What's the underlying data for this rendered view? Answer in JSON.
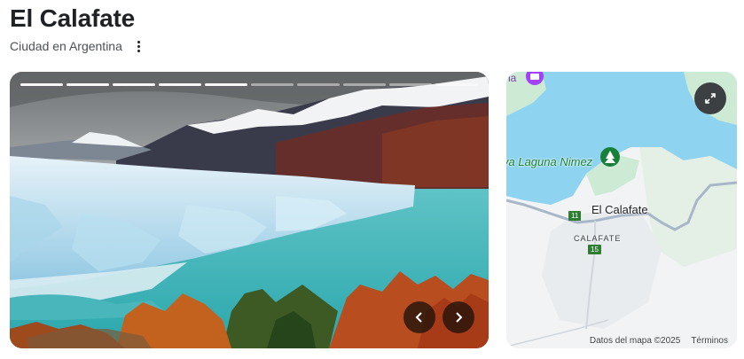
{
  "header": {
    "title": "El Calafate",
    "subtitle": "Ciudad en Argentina",
    "more_icon": "more-vert-icon"
  },
  "photo_carousel": {
    "slide_count": 10,
    "active_slides": 5,
    "prev_icon": "chevron-left-icon",
    "next_icon": "chevron-right-icon"
  },
  "map": {
    "city_label": "El Calafate",
    "area_label": "CALAFATE",
    "lake_label": "va Laguna Nimez",
    "top_label": "na",
    "routes": [
      "11",
      "15"
    ],
    "attribution": "Datos del mapa ©2025",
    "terms": "Términos",
    "expand_icon": "expand-icon",
    "colors": {
      "water": "#8ed3f0",
      "land": "#f1f3f4",
      "park": "#cdebd4",
      "road": "#a8b7c8"
    }
  }
}
